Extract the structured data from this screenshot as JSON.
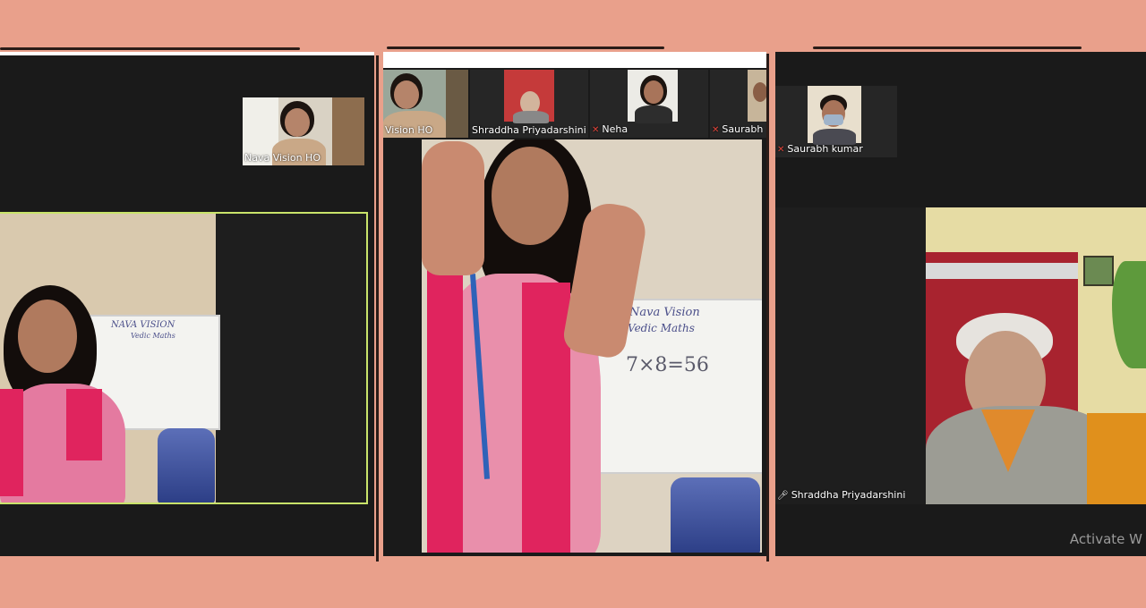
{
  "left_panel": {
    "thumbnail": {
      "name": "Nava Vision HO",
      "mic_muted": false
    }
  },
  "middle_panel": {
    "strip": [
      {
        "name": "Vision HO",
        "mic_muted": false
      },
      {
        "name": "Shraddha Priyadarshini",
        "mic_muted": false
      },
      {
        "name": "Neha",
        "mic_muted": true
      },
      {
        "name": "Saurabh",
        "mic_muted": true
      }
    ],
    "whiteboard": {
      "line1": "Nava Vision",
      "line2": "Vedic Maths",
      "equation": "7×8=56"
    }
  },
  "right_panel": {
    "thumbnail": {
      "name": "Saurabh kumar",
      "mic_muted": true
    },
    "speaker": {
      "name": "Shraddha Priyadarshini",
      "mic_muted": false
    },
    "watermark": "Activate W"
  },
  "left_whiteboard": {
    "line1": "NAVA VISION",
    "line2": "Vedic Maths"
  },
  "icons": {
    "mic_off": "microphone-off-icon",
    "mic_on": "microphone-icon"
  },
  "colors": {
    "background": "#E9A08B",
    "panel": "#1A1A1A",
    "active_speaker_border": "#C9E36A",
    "muted_mic": "#E0443A"
  }
}
